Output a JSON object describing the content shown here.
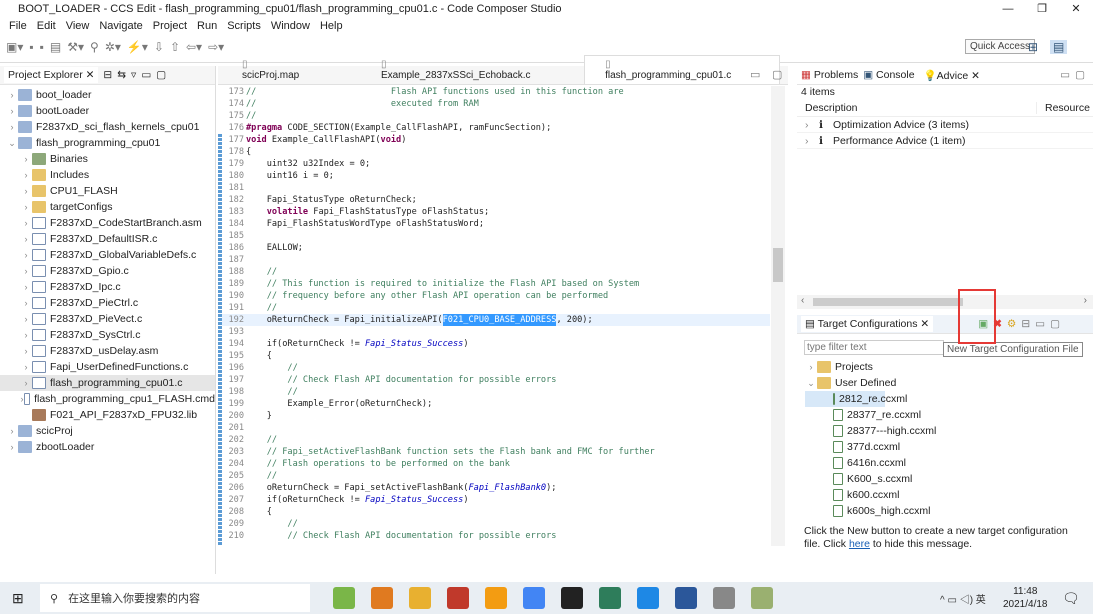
{
  "window": {
    "title": "BOOT_LOADER - CCS Edit - flash_programming_cpu01/flash_programming_cpu01.c - Code Composer Studio",
    "minimize": "—",
    "maximize": "❐",
    "close": "✕"
  },
  "menu": [
    "File",
    "Edit",
    "View",
    "Navigate",
    "Project",
    "Run",
    "Scripts",
    "Window",
    "Help"
  ],
  "toolbar": {
    "quick_access": "Quick Access"
  },
  "project_explorer": {
    "tab": "Project Explorer",
    "items": [
      {
        "label": "boot_loader",
        "level": 0,
        "icon": "project",
        "expanded": false
      },
      {
        "label": "bootLoader",
        "level": 0,
        "icon": "project",
        "expanded": false
      },
      {
        "label": "F2837xD_sci_flash_kernels_cpu01",
        "level": 0,
        "icon": "project",
        "expanded": false
      },
      {
        "label": "flash_programming_cpu01",
        "level": 0,
        "icon": "project",
        "expanded": true
      },
      {
        "label": "Binaries",
        "level": 1,
        "icon": "binaries"
      },
      {
        "label": "Includes",
        "level": 1,
        "icon": "folder"
      },
      {
        "label": "CPU1_FLASH",
        "level": 1,
        "icon": "folder"
      },
      {
        "label": "targetConfigs",
        "level": 1,
        "icon": "folder"
      },
      {
        "label": "F2837xD_CodeStartBranch.asm",
        "level": 1,
        "icon": "file"
      },
      {
        "label": "F2837xD_DefaultISR.c",
        "level": 1,
        "icon": "file"
      },
      {
        "label": "F2837xD_GlobalVariableDefs.c",
        "level": 1,
        "icon": "file"
      },
      {
        "label": "F2837xD_Gpio.c",
        "level": 1,
        "icon": "file"
      },
      {
        "label": "F2837xD_Ipc.c",
        "level": 1,
        "icon": "file"
      },
      {
        "label": "F2837xD_PieCtrl.c",
        "level": 1,
        "icon": "file"
      },
      {
        "label": "F2837xD_PieVect.c",
        "level": 1,
        "icon": "file"
      },
      {
        "label": "F2837xD_SysCtrl.c",
        "level": 1,
        "icon": "file"
      },
      {
        "label": "F2837xD_usDelay.asm",
        "level": 1,
        "icon": "file"
      },
      {
        "label": "Fapi_UserDefinedFunctions.c",
        "level": 1,
        "icon": "file"
      },
      {
        "label": "flash_programming_cpu01.c",
        "level": 1,
        "icon": "file",
        "selected": true
      },
      {
        "label": "flash_programming_cpu1_FLASH.cmd",
        "level": 1,
        "icon": "file"
      },
      {
        "label": "F021_API_F2837xD_FPU32.lib",
        "level": 1,
        "icon": "lib",
        "leaf": true
      },
      {
        "label": "scicProj",
        "level": 0,
        "icon": "project",
        "expanded": false
      },
      {
        "label": "zbootLoader",
        "level": 0,
        "icon": "project",
        "expanded": false
      }
    ]
  },
  "editor": {
    "tabs": [
      {
        "label": "scicProj.map"
      },
      {
        "label": "Example_2837xSSci_Echoback.c"
      },
      {
        "label": "flash_programming_cpu01.c",
        "active": true
      }
    ],
    "lines": [
      {
        "n": "173",
        "t": [
          [
            "cm",
            "//                          Flash API functions used in this function are"
          ]
        ]
      },
      {
        "n": "174",
        "t": [
          [
            "cm",
            "//                          executed from RAM"
          ]
        ]
      },
      {
        "n": "175",
        "t": [
          [
            "cm",
            "//"
          ]
        ]
      },
      {
        "n": "176",
        "t": [
          [
            "kw",
            "#pragma"
          ],
          [
            "tx",
            " CODE_SECTION(Example_CallFlashAPI, ramFuncSection);"
          ]
        ]
      },
      {
        "n": "177",
        "t": [
          [
            "kw",
            "void"
          ],
          [
            "tx",
            " Example_CallFlashAPI("
          ],
          [
            "kw",
            "void"
          ],
          [
            "tx",
            ")"
          ]
        ]
      },
      {
        "n": "178",
        "t": [
          [
            "tx",
            "{"
          ]
        ]
      },
      {
        "n": "179",
        "t": [
          [
            "tx",
            "    uint32 u32Index = 0;"
          ]
        ]
      },
      {
        "n": "180",
        "t": [
          [
            "tx",
            "    uint16 i = 0;"
          ]
        ]
      },
      {
        "n": "181",
        "t": [
          [
            "tx",
            ""
          ]
        ]
      },
      {
        "n": "182",
        "t": [
          [
            "tx",
            "    Fapi_StatusType oReturnCheck;"
          ]
        ]
      },
      {
        "n": "183",
        "t": [
          [
            "kw",
            "    volatile"
          ],
          [
            "tx",
            " Fapi_FlashStatusType oFlashStatus;"
          ]
        ]
      },
      {
        "n": "184",
        "t": [
          [
            "tx",
            "    Fapi_FlashStatusWordType oFlashStatusWord;"
          ]
        ]
      },
      {
        "n": "185",
        "t": [
          [
            "tx",
            ""
          ]
        ]
      },
      {
        "n": "186",
        "t": [
          [
            "tx",
            "    EALLOW;"
          ]
        ]
      },
      {
        "n": "187",
        "t": [
          [
            "tx",
            ""
          ]
        ]
      },
      {
        "n": "188",
        "t": [
          [
            "cm",
            "    //"
          ]
        ]
      },
      {
        "n": "189",
        "t": [
          [
            "cm",
            "    // This function is required to initialize the Flash API based on System"
          ]
        ]
      },
      {
        "n": "190",
        "t": [
          [
            "cm",
            "    // frequency before any other Flash API operation can be performed"
          ]
        ]
      },
      {
        "n": "191",
        "t": [
          [
            "cm",
            "    //"
          ]
        ]
      },
      {
        "n": "192",
        "hl": true,
        "t": [
          [
            "tx",
            "    oReturnCheck = Fapi_initializeAPI("
          ],
          [
            "sl",
            "F021_CPU0_BASE_ADDRESS"
          ],
          [
            "tx",
            ", 200);"
          ]
        ]
      },
      {
        "n": "193",
        "t": [
          [
            "tx",
            ""
          ]
        ]
      },
      {
        "n": "194",
        "t": [
          [
            "tx",
            "    if(oReturnCheck != "
          ],
          [
            "it",
            "Fapi_Status_Success"
          ],
          [
            "tx",
            ")"
          ]
        ]
      },
      {
        "n": "195",
        "t": [
          [
            "tx",
            "    {"
          ]
        ]
      },
      {
        "n": "196",
        "t": [
          [
            "cm",
            "        //"
          ]
        ]
      },
      {
        "n": "197",
        "t": [
          [
            "cm",
            "        // Check Flash API documentation for possible errors"
          ]
        ]
      },
      {
        "n": "198",
        "t": [
          [
            "cm",
            "        //"
          ]
        ]
      },
      {
        "n": "199",
        "t": [
          [
            "tx",
            "        Example_Error(oReturnCheck);"
          ]
        ]
      },
      {
        "n": "200",
        "t": [
          [
            "tx",
            "    }"
          ]
        ]
      },
      {
        "n": "201",
        "t": [
          [
            "tx",
            ""
          ]
        ]
      },
      {
        "n": "202",
        "t": [
          [
            "cm",
            "    //"
          ]
        ]
      },
      {
        "n": "203",
        "t": [
          [
            "cm",
            "    // Fapi_setActiveFlashBank function sets the Flash bank and FMC for further"
          ]
        ]
      },
      {
        "n": "204",
        "t": [
          [
            "cm",
            "    // Flash operations to be performed on the bank"
          ]
        ]
      },
      {
        "n": "205",
        "t": [
          [
            "cm",
            "    //"
          ]
        ]
      },
      {
        "n": "206",
        "t": [
          [
            "tx",
            "    oReturnCheck = Fapi_setActiveFlashBank("
          ],
          [
            "it",
            "Fapi_FlashBank0"
          ],
          [
            "tx",
            ");"
          ]
        ]
      },
      {
        "n": "207",
        "t": [
          [
            "tx",
            "    if(oReturnCheck != "
          ],
          [
            "it",
            "Fapi_Status_Success"
          ],
          [
            "tx",
            ")"
          ]
        ]
      },
      {
        "n": "208",
        "t": [
          [
            "tx",
            "    {"
          ]
        ]
      },
      {
        "n": "209",
        "t": [
          [
            "cm",
            "        //"
          ]
        ]
      },
      {
        "n": "210",
        "t": [
          [
            "cm",
            "        // Check Flash API documentation for possible errors"
          ]
        ]
      }
    ]
  },
  "advice": {
    "tabs": [
      "Problems",
      "Console",
      "Advice"
    ],
    "count": "4 items",
    "columns": [
      "Description",
      "Resource"
    ],
    "rows": [
      "Optimization Advice (3 items)",
      "Performance Advice (1 item)"
    ]
  },
  "target_configs": {
    "tab": "Target Configurations",
    "filter_placeholder": "type filter text",
    "tooltip": "New Target Configuration File",
    "groups": [
      {
        "label": "Projects",
        "expanded": false
      },
      {
        "label": "User Defined",
        "expanded": true
      }
    ],
    "files": [
      "2812_re.ccxml",
      "28377_re.ccxml",
      "28377---high.ccxml",
      "377d.ccxml",
      "6416n.ccxml",
      "K600_s.ccxml",
      "k600.ccxml",
      "k600s_high.ccxml"
    ],
    "message_pre": "Click the New button to create a new target configuration file. Click ",
    "message_link": "here",
    "message_post": " to hide this message."
  },
  "taskbar": {
    "search_placeholder": "在这里输入你要搜索的内容",
    "time": "11:48",
    "date": "2021/4/18",
    "tray": "^  ▭  ◁)  英",
    "apps": [
      "#7ab648",
      "#e07a20",
      "#e8b030",
      "#c0392b",
      "#f39c12",
      "#4285f4",
      "#222222",
      "#2e7d5b",
      "#1e88e5",
      "#2b579a",
      "#888888",
      "#9ab070"
    ]
  }
}
